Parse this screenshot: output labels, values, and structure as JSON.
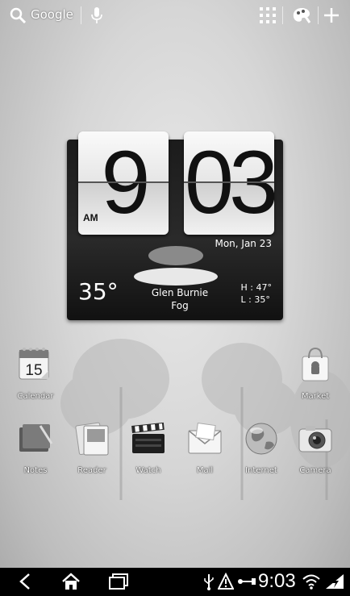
{
  "topbar": {
    "search_label": "Google"
  },
  "clock_widget": {
    "hour": "9",
    "minute": "03",
    "ampm": "AM",
    "date": "Mon, Jan 23",
    "temperature": "35°",
    "city": "Glen Burnie",
    "condition": "Fog",
    "high": "H : 47°",
    "low": "L : 35°"
  },
  "apps": {
    "calendar": {
      "label": "Calendar",
      "day": "15"
    },
    "market": {
      "label": "Market"
    },
    "notes": {
      "label": "Notes"
    },
    "reader": {
      "label": "Reader"
    },
    "watch": {
      "label": "Watch"
    },
    "mail": {
      "label": "Mail"
    },
    "internet": {
      "label": "Internet"
    },
    "camera": {
      "label": "Camera"
    }
  },
  "navbar": {
    "time": "9:03"
  },
  "colors": {
    "navbar_bg": "#000000",
    "widget_bg": "#1b1b1b",
    "wallpaper": "#d6d6d6"
  }
}
